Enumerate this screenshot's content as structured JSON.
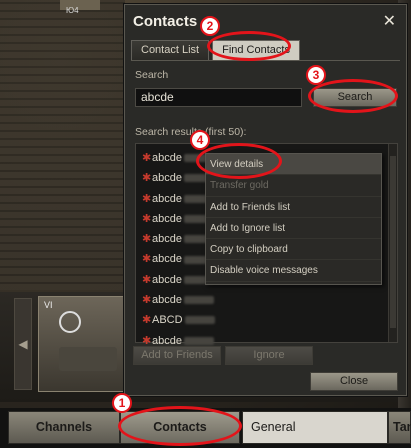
{
  "background": {
    "tank_label_top": "Ю4",
    "tier": "VI"
  },
  "window": {
    "title": "Contacts",
    "tabs": [
      {
        "label": "Contact List"
      },
      {
        "label": "Find Contacts"
      }
    ],
    "search_label": "Search",
    "search_value": "abcde",
    "search_button": "Search",
    "results_label": "Search results (first 50):",
    "results": [
      {
        "name": "abcde"
      },
      {
        "name": "abcde"
      },
      {
        "name": "abcde"
      },
      {
        "name": "abcde"
      },
      {
        "name": "abcde"
      },
      {
        "name": "abcde"
      },
      {
        "name": "abcde"
      },
      {
        "name": "abcde"
      },
      {
        "name": "ABCD"
      },
      {
        "name": "abcde"
      }
    ],
    "context_menu": [
      "View details",
      "Transfer gold",
      "Add to Friends list",
      "Add to Ignore list",
      "Copy to clipboard",
      "Disable voice messages"
    ],
    "add_friends_button": "Add to Friends",
    "ignore_button": "Ignore",
    "close_button": "Close"
  },
  "taskbar": {
    "channels": "Channels",
    "contacts": "Contacts",
    "general": "General",
    "tank": "Tan"
  },
  "annotations": [
    "1",
    "2",
    "3",
    "4"
  ],
  "colors": {
    "annotation_red": "#e3141a",
    "status_dot": "#c53a2d"
  }
}
